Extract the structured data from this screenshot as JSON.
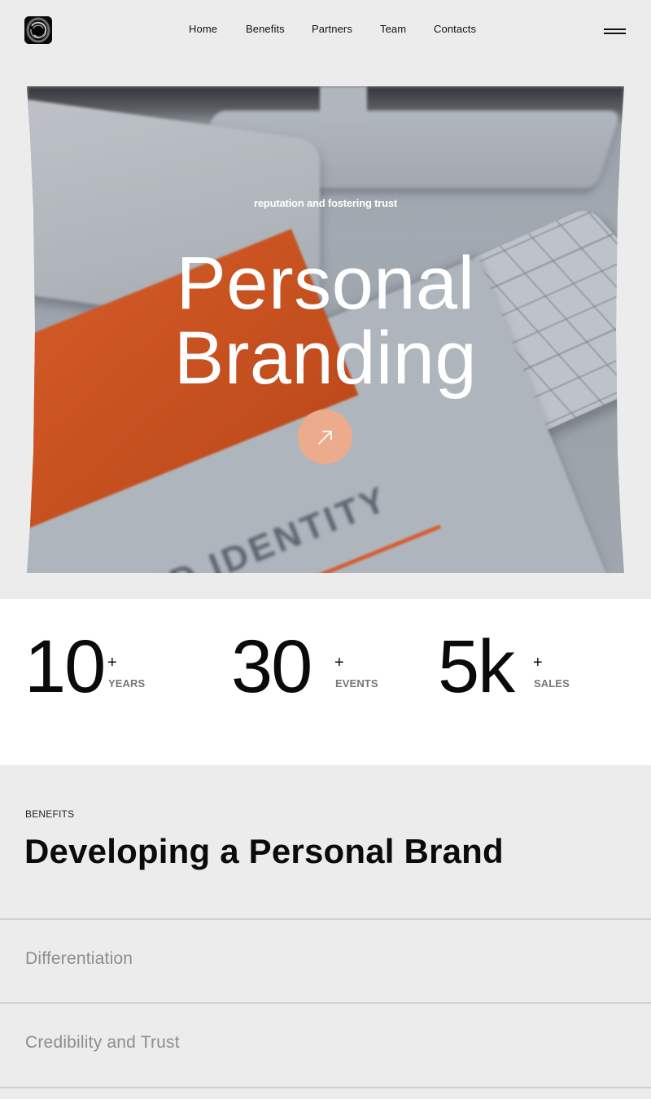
{
  "header": {
    "logo_icon": "swirl-logo-icon",
    "nav": [
      {
        "label": "Home"
      },
      {
        "label": "Benefits"
      },
      {
        "label": "Partners"
      },
      {
        "label": "Team"
      },
      {
        "label": "Contacts"
      }
    ],
    "menu_icon": "hamburger-menu-icon"
  },
  "hero": {
    "subtitle": "reputation and fostering trust",
    "title_line1": "Personal",
    "title_line2": "Branding",
    "cta_icon": "arrow-up-right-icon",
    "cta_color": "#ebab8c",
    "image_description": "Blurred desk scene with laptop, keyboard, and orange 'Brand Identity' book",
    "book_text": "BRAND IDENTITY"
  },
  "stats": [
    {
      "value": "10",
      "suffix": "+",
      "label": "YEARS"
    },
    {
      "value": "30",
      "suffix": "+",
      "label": "EVENTS"
    },
    {
      "value": "5k",
      "suffix": "+",
      "label": "SALES"
    }
  ],
  "benefits": {
    "eyebrow": "BENEFITS",
    "heading": "Developing a Personal Brand",
    "items": [
      {
        "label": "Differentiation"
      },
      {
        "label": "Credibility and Trust"
      }
    ]
  },
  "colors": {
    "page_bg": "#ececec",
    "stats_bg": "#ffffff",
    "accent": "#ebab8c",
    "muted_text": "#8d8d8d"
  }
}
